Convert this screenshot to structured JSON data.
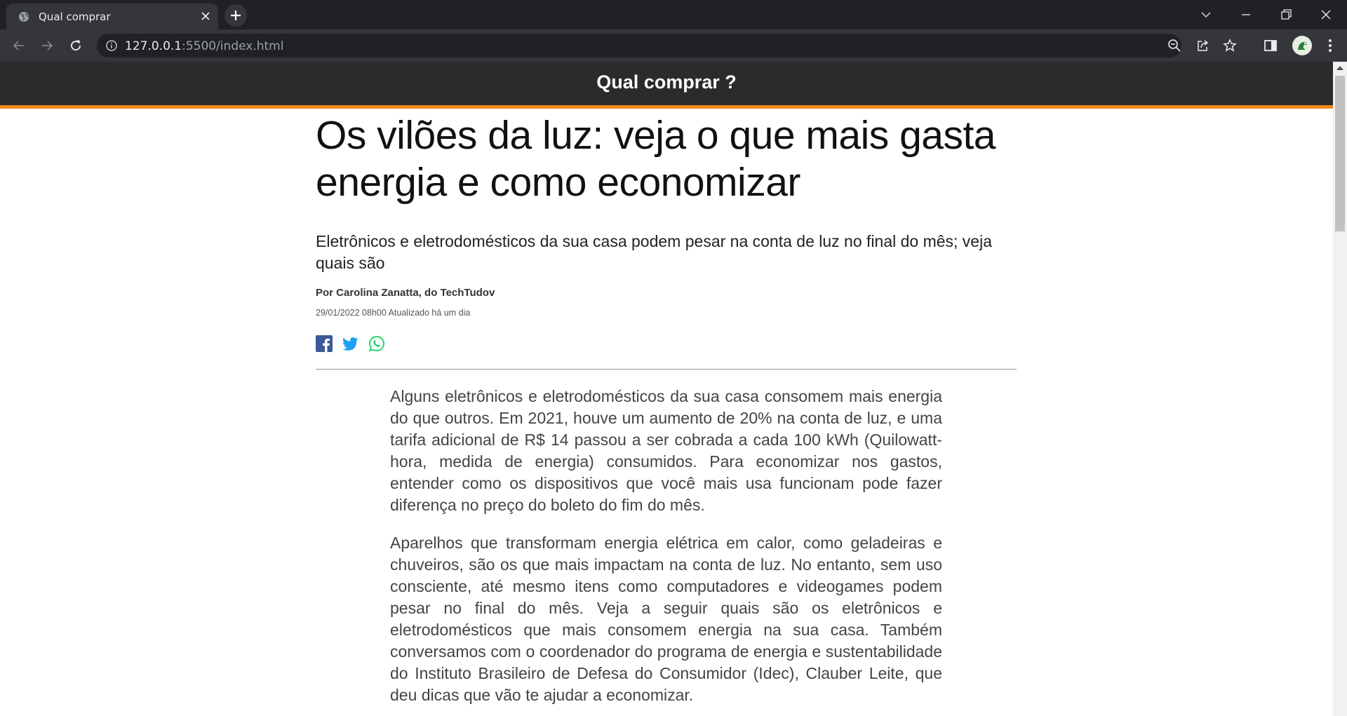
{
  "browser": {
    "tab_title": "Qual comprar",
    "url_host": "127.0.0.1",
    "url_path": ":5500/index.html"
  },
  "site": {
    "title": "Qual comprar ?",
    "accent_color": "#f08a1c",
    "header_color": "#2b2b2b"
  },
  "article": {
    "title": "Os vilões da luz: veja o que mais gasta energia e como economizar",
    "subtitle": "Eletrônicos e eletrodomésticos da sua casa podem pesar na conta de luz no final do mês; veja quais são",
    "byline": "Por Carolina Zanatta, do TechTudov",
    "dateline": "29/01/2022 08h00 Atualizado há um dia",
    "share": [
      {
        "icon": "facebook-icon",
        "color": "#3b5998"
      },
      {
        "icon": "twitter-icon",
        "color": "#1da1f2"
      },
      {
        "icon": "whatsapp-icon",
        "color": "#25d366"
      }
    ],
    "paragraphs": [
      "Alguns eletrônicos e eletrodomésticos da sua casa consomem mais energia do que outros. Em 2021, houve um aumento de 20% na conta de luz, e uma tarifa adicional de R$ 14 passou a ser cobrada a cada 100 kWh (Quilowatt-hora, medida de energia) consumidos. Para economizar nos gastos, entender como os dispositivos que você mais usa funcionam pode fazer diferença no preço do boleto do fim do mês.",
      "Aparelhos que transformam energia elétrica em calor, como geladeiras e chuveiros, são os que mais impactam na conta de luz. No entanto, sem uso consciente, até mesmo itens como computadores e videogames podem pesar no final do mês. Veja a seguir quais são os eletrônicos e eletrodomésticos que mais consomem energia na sua casa. Também conversamos com o coordenador do programa de energia e sustentabilidade do Instituto Brasileiro de Defesa do Consumidor (Idec), Clauber Leite, que deu dicas que vão te ajudar a economizar."
    ]
  }
}
